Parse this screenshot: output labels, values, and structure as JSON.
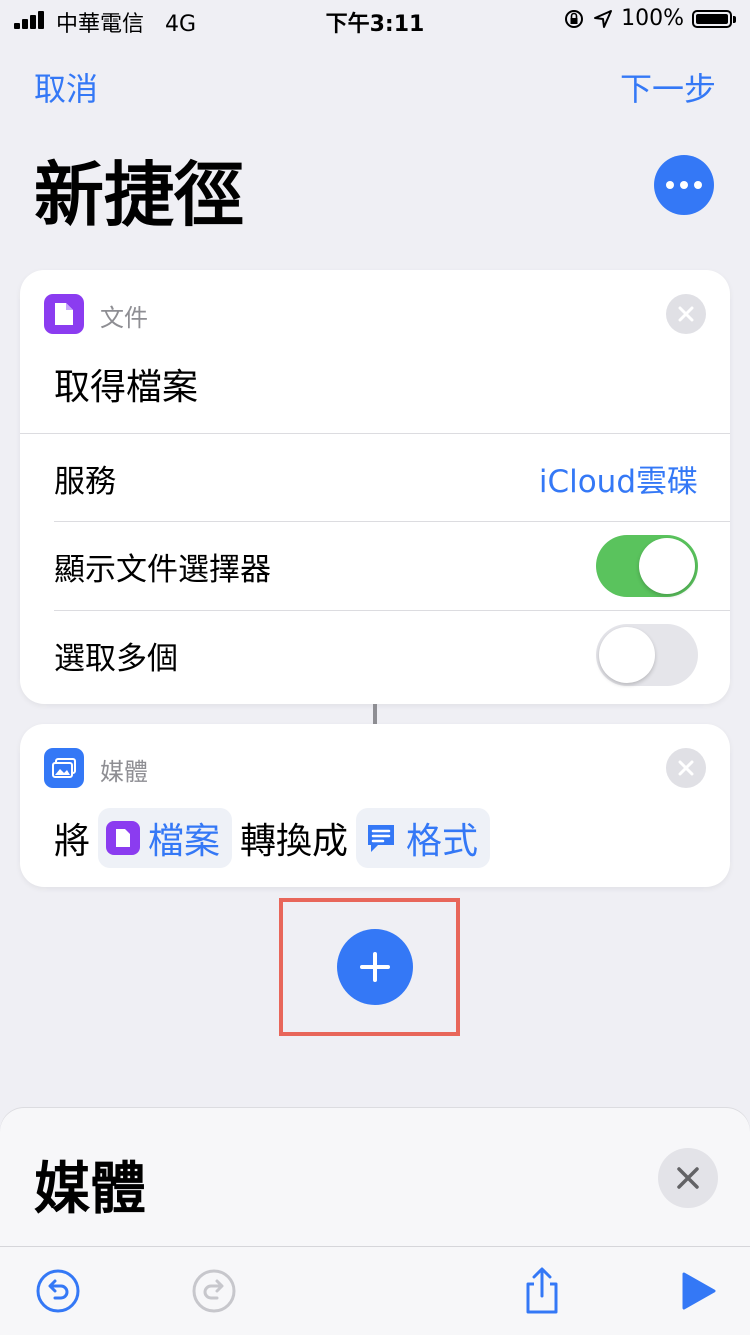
{
  "status_bar": {
    "carrier": "中華電信",
    "network": "4G",
    "time": "下午3:11",
    "battery": "100%"
  },
  "nav": {
    "cancel_label": "取消",
    "next_label": "下一步"
  },
  "page": {
    "title": "新捷徑"
  },
  "card_documents": {
    "category": "文件",
    "title": "取得檔案",
    "rows": [
      {
        "label": "服務",
        "value": "iCloud雲碟"
      },
      {
        "label": "顯示文件選擇器",
        "toggle": true
      },
      {
        "label": "選取多個",
        "toggle": false
      }
    ]
  },
  "card_media": {
    "category": "媒體",
    "sentence": {
      "prefix": "將",
      "token1": "檔案",
      "middle": "轉換成",
      "token2": "格式"
    }
  },
  "sheet": {
    "title": "媒體"
  },
  "colors": {
    "accent": "#3478f6",
    "documents": "#8b3cf0",
    "toggle_on": "#5ac35d",
    "highlight": "#e8665a"
  }
}
